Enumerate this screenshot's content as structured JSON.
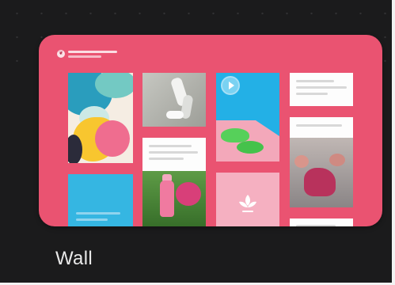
{
  "template": {
    "name": "Wall",
    "brand_icon": "leaf-logo-icon"
  },
  "colors": {
    "card_background": "#ea5371",
    "page_background": "#1b1b1c",
    "label": "#e9e9e9"
  },
  "icons": [
    "play-icon",
    "leaf-icon"
  ]
}
